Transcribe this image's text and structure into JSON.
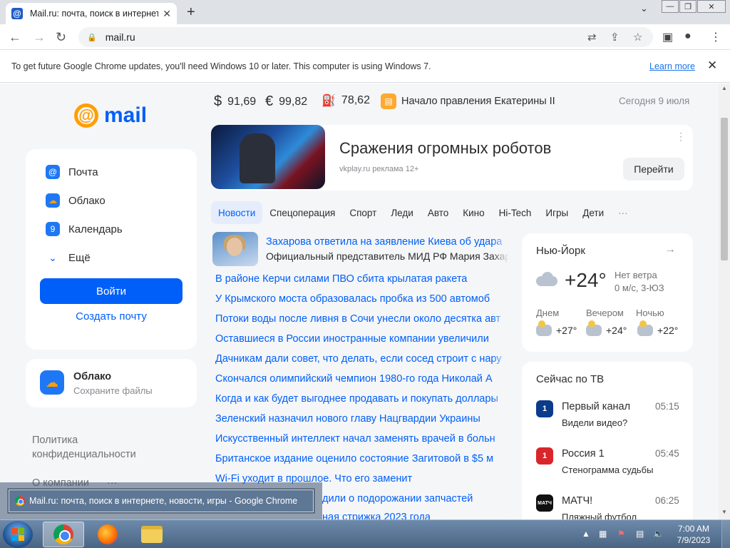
{
  "browser": {
    "tab_title": "Mail.ru: почта, поиск в интернете",
    "url": "mail.ru",
    "infobar_text": "To get future Google Chrome updates, you'll need Windows 10 or later. This computer is using Windows 7.",
    "infobar_link": "Learn more"
  },
  "sidebar": {
    "logo_text": "mail",
    "items": [
      {
        "label": "Почта",
        "icon": "mail-icon",
        "color": "#1e78f5"
      },
      {
        "label": "Облако",
        "icon": "cloud-icon",
        "color": "#1e78f5"
      },
      {
        "label": "Календарь",
        "icon": "calendar-icon",
        "color": "#1e78f5"
      },
      {
        "label": "Ещё",
        "icon": "chevron-down-icon"
      }
    ],
    "login_button": "Войти",
    "create_link": "Создать почту",
    "cloud_card": {
      "title": "Облако",
      "subtitle": "Сохраните файлы"
    },
    "footer_links": [
      "Политика конфиденциальности",
      "О компании"
    ],
    "footer_more": "···"
  },
  "topline": {
    "usd": "91,69",
    "eur": "99,82",
    "oil": "78,62",
    "usd_symbol": "$",
    "eur_symbol": "€",
    "oil_symbol": "⛽",
    "event": "Начало правления Екатерины II",
    "date": "Сегодня 9 июля"
  },
  "ad": {
    "title": "Сражения огромных роботов",
    "meta": "vkplay.ru   реклама   12+",
    "button": "Перейти",
    "dots": "⋮"
  },
  "news_tabs": [
    "Новости",
    "Спецоперация",
    "Спорт",
    "Леди",
    "Авто",
    "Кино",
    "Hi-Tech",
    "Игры",
    "Дети",
    "···"
  ],
  "news": {
    "top_headline": "Захарова ответила на заявление Киева об удара",
    "top_sub": "Официальный представитель МИД РФ Мария Захар",
    "items": [
      "В районе Керчи силами ПВО сбита крылатая ракета",
      "У Крымского моста образовалась пробка из 500 автомоб",
      "Потоки воды после ливня в Сочи унесли около десятка авт",
      "Оставшиеся в России иностранные компании увеличили",
      "Дачникам дали совет, что делать, если сосед строит с нару",
      "Скончался олимпийский чемпион 1980-го года Николай А",
      "Когда и как будет выгоднее продавать и покупать доллары",
      "Зеленский назначил нового главу Нацгвардии Украины",
      "Искусственный интеллект начал заменять врачей в больн",
      "Британское издание оценило состояние Загитовой в $5 м",
      "Wi-Fi уходит в прошлое. Что его заменит",
      "дили о подорожании запчастей",
      "ная стрижка 2023 года"
    ]
  },
  "weather": {
    "city": "Нью-Йорк",
    "temp": "+24°",
    "wind": "Нет ветра",
    "wind_detail": "0 м/с, 3-ЮЗ",
    "periods": [
      {
        "label": "Днем",
        "temp": "+27°"
      },
      {
        "label": "Вечером",
        "temp": "+24°"
      },
      {
        "label": "Ночью",
        "temp": "+22°"
      }
    ]
  },
  "tv": {
    "title": "Сейчас по ТВ",
    "channels": [
      {
        "name": "Первый канал",
        "time": "05:15",
        "program": "Видели видео?",
        "logo": "1",
        "color": "#0b3c8c"
      },
      {
        "name": "Россия 1",
        "time": "05:45",
        "program": "Стенограмма судьбы",
        "logo": "1",
        "color": "#d8262b"
      },
      {
        "name": "МАТЧ!",
        "time": "06:25",
        "program": "Пляжный футбол",
        "logo": "МАТЧ",
        "color": "#111111"
      }
    ]
  },
  "tooltip": "Mail.ru: почта, поиск в интернете, новости, игры - Google Chrome",
  "taskbar": {
    "time": "7:00 AM",
    "date": "7/9/2023"
  }
}
